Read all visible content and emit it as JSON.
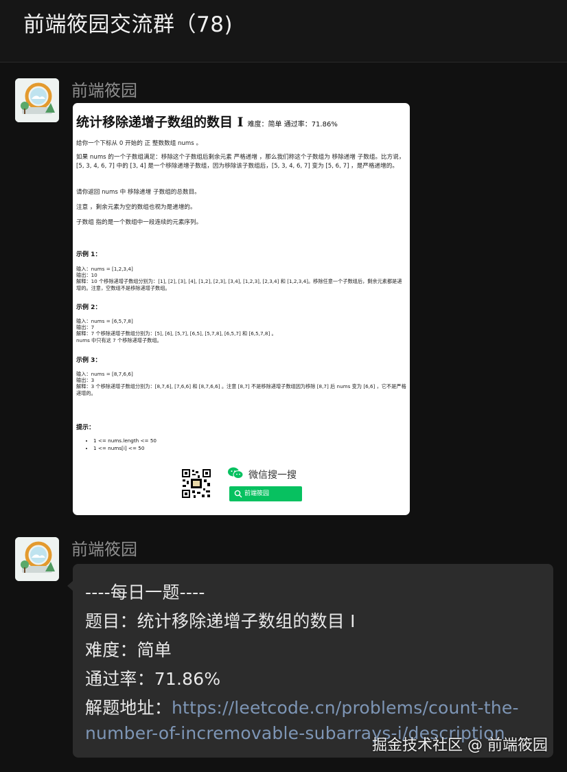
{
  "header": {
    "title": "前端筱园交流群（78)"
  },
  "messages": [
    {
      "sender": "前端筱园"
    },
    {
      "sender": "前端筱园"
    }
  ],
  "problem_image": {
    "title": "统计移除递增子数组的数目 I",
    "meta": "难度：简单  通过率：71.86%",
    "para1": "给你一个下标从 0 开始的 正 整数数组 nums 。",
    "para2": "如果 nums 的一个子数组满足：移除这个子数组后剩余元素 严格递增 ，那么我们称这个子数组为 移除递增 子数组。比方说，[5, 3, 4, 6, 7] 中的 [3, 4] 是一个移除递增子数组，因为移除该子数组后，[5, 3, 4, 6, 7] 变为 [5, 6, 7] ，是严格递增的。",
    "para3": "请你返回 nums 中 移除递增 子数组的总数目。",
    "para4": "注意 ，剩余元素为空的数组也视为是递增的。",
    "para5": "子数组 指的是一个数组中一段连续的元素序列。",
    "ex1_head": "示例 1：",
    "ex1_l1": "输入：nums = [1,2,3,4]",
    "ex1_l2": "输出：10",
    "ex1_l3": "解释：10 个移除递增子数组分别为：[1], [2], [3], [4], [1,2], [2,3], [3,4], [1,2,3], [2,3,4] 和 [1,2,3,4]。移除任意一个子数组后，剩余元素都是递增的。注意，空数组不是移除递增子数组。",
    "ex2_head": "示例 2：",
    "ex2_l1": "输入：nums = [6,5,7,8]",
    "ex2_l2": "输出：7",
    "ex2_l3": "解释：7 个移除递增子数组分别为：[5], [6], [5,7], [6,5], [5,7,8], [6,5,7] 和 [6,5,7,8] 。",
    "ex2_l4": "nums 中只有这 7 个移除递增子数组。",
    "ex3_head": "示例 3：",
    "ex3_l1": "输入：nums = [8,7,6,6]",
    "ex3_l2": "输出：3",
    "ex3_l3": "解释：3 个移除递增子数组分别为：[8,7,6], [7,6,6] 和 [8,7,6,6] 。注意 [8,7] 不是移除递增子数组因为移除 [8,7] 后 nums 变为 [6,6] ，它不是严格递增的。",
    "hint_head": "提示：",
    "hints": [
      "1 <= nums.length <= 50",
      "1 <= nums[i] <= 50"
    ],
    "wechat_search_label": "微信搜一搜",
    "wechat_search_query": "前端筱园"
  },
  "text_message": {
    "line1": "----每日一题----",
    "line2": "题目：统计移除递增子数组的数目 I",
    "line3": "难度：简单",
    "line4": "通过率：71.86%",
    "line5_label": "解题地址：",
    "link_part1": "https://leetcode.cn/problems/count-the-",
    "link_part2": "number-of-incremovable-subarrays-i/description"
  },
  "watermark": "掘金技术社区 @ 前端筱园",
  "colors": {
    "background": "#111111",
    "bubble": "#2c2c2c",
    "link": "#7e96b6",
    "wechat_green": "#07c160"
  }
}
